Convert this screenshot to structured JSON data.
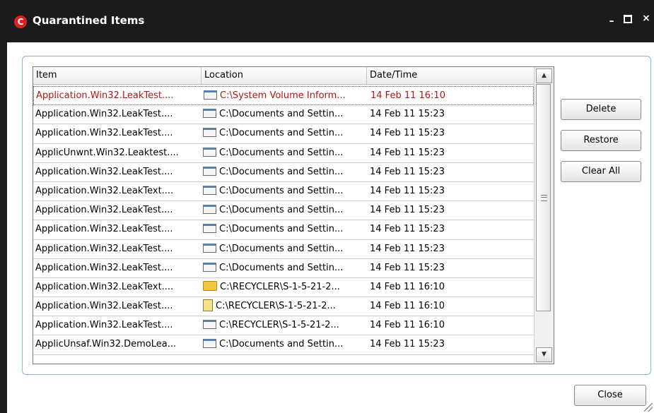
{
  "window": {
    "title": "Quarantined Items",
    "logo_letter": "C",
    "minimize_glyph": "–",
    "close_glyph": "×"
  },
  "list": {
    "columns": [
      "Item",
      "Location",
      "Date/Time"
    ],
    "rows": [
      {
        "item": "Application.Win32.LeakTest....",
        "location": "C:\\System Volume Inform...",
        "datetime": "14 Feb 11 16:10",
        "icon": "window-icon",
        "selected": true
      },
      {
        "item": "Application.Win32.LeakTest....",
        "location": "C:\\Documents and Settin...",
        "datetime": "14 Feb 11 15:23",
        "icon": "window-icon"
      },
      {
        "item": "Application.Win32.LeakTest....",
        "location": "C:\\Documents and Settin...",
        "datetime": "14 Feb 11 15:23",
        "icon": "window-icon"
      },
      {
        "item": "ApplicUnwnt.Win32.Leaktest....",
        "location": "C:\\Documents and Settin...",
        "datetime": "14 Feb 11 15:23",
        "icon": "window-icon"
      },
      {
        "item": "Application.Win32.LeakTest....",
        "location": "C:\\Documents and Settin...",
        "datetime": "14 Feb 11 15:23",
        "icon": "window-icon"
      },
      {
        "item": "Application.Win32.LeakText....",
        "location": "C:\\Documents and Settin...",
        "datetime": "14 Feb 11 15:23",
        "icon": "window-icon"
      },
      {
        "item": "Application.Win32.LeakTest....",
        "location": "C:\\Documents and Settin...",
        "datetime": "14 Feb 11 15:23",
        "icon": "window-icon"
      },
      {
        "item": "Application.Win32.LeakTest....",
        "location": "C:\\Documents and Settin...",
        "datetime": "14 Feb 11 15:23",
        "icon": "window-icon"
      },
      {
        "item": "Application.Win32.LeakTest....",
        "location": "C:\\Documents and Settin...",
        "datetime": "14 Feb 11 15:23",
        "icon": "window-icon"
      },
      {
        "item": "Application.Win32.LeakTest....",
        "location": "C:\\Documents and Settin...",
        "datetime": "14 Feb 11 15:23",
        "icon": "window-icon"
      },
      {
        "item": "Application.Win32.LeakText....",
        "location": "C:\\RECYCLER\\S-1-5-21-2...",
        "datetime": "14 Feb 11 16:10",
        "icon": "folder-icon"
      },
      {
        "item": "Application.Win32.LeakTest....",
        "location": "C:\\RECYCLER\\S-1-5-21-2...",
        "datetime": "14 Feb 11 16:10",
        "icon": "zip-icon"
      },
      {
        "item": "Application.Win32.LeakTest....",
        "location": "C:\\RECYCLER\\S-1-5-21-2...",
        "datetime": "14 Feb 11 16:10",
        "icon": "window-icon"
      },
      {
        "item": "ApplicUnsaf.Win32.DemoLea...",
        "location": "C:\\Documents and Settin...",
        "datetime": "14 Feb 11 15:23",
        "icon": "window-icon"
      }
    ]
  },
  "buttons": {
    "delete": "Delete",
    "restore": "Restore",
    "clear_all": "Clear All",
    "close": "Close"
  },
  "colors": {
    "titlebar": "#1b1b1b",
    "selected_text": "#b01818",
    "frame_border": "#8fb3d9"
  }
}
